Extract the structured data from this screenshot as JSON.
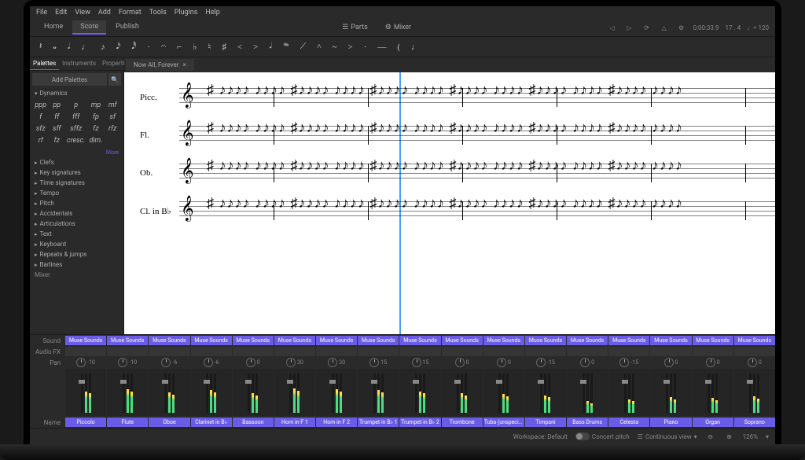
{
  "menu": [
    "File",
    "Edit",
    "View",
    "Add",
    "Format",
    "Tools",
    "Plugins",
    "Help"
  ],
  "mainTabs": [
    "Home",
    "Score",
    "Publish"
  ],
  "activeMainTab": 1,
  "centerTabs": {
    "parts": "Parts",
    "mixer": "Mixer"
  },
  "playback": {
    "time": "0:00:33.9",
    "beat": "17 . 4",
    "tempo": "♩= 120"
  },
  "noteToolbar": [
    "𝄽",
    "𝅝",
    "𝅗𝅥",
    "♩",
    "♪",
    "𝅘𝅥𝅯",
    "𝅘𝅥𝅰",
    "·",
    "𝄐",
    "⌐",
    "♭",
    "♮",
    "♯",
    "<",
    ">",
    "𝆺𝅥",
    "𝆮",
    "⟋",
    "^",
    "~",
    ">",
    "·",
    "—",
    "(",
    "♩"
  ],
  "leftPanel": {
    "tabs": [
      "Palettes",
      "Instruments",
      "Properties"
    ],
    "activeTab": 0,
    "addBtn": "Add Palettes",
    "dynamics": {
      "title": "Dynamics",
      "items": [
        "ppp",
        "pp",
        "p",
        "mp",
        "mf",
        "f",
        "ff",
        "fff",
        "fp",
        "sf",
        "sfz",
        "sff",
        "sffz",
        "fz",
        "rfz",
        "rf",
        "fz",
        "cresc.",
        "dim."
      ],
      "more": "More"
    },
    "sections": [
      "Clefs",
      "Key signatures",
      "Time signatures",
      "Tempo",
      "Pitch",
      "Accidentals",
      "Articulations",
      "Text",
      "Keyboard",
      "Repeats & jumps",
      "Barlines"
    ]
  },
  "docTab": {
    "name": "Now All, Forever"
  },
  "instruments": [
    "Picc.",
    "Fl.",
    "Ob.",
    "Cl. in B♭"
  ],
  "mixer": {
    "label": "Mixer",
    "rows": {
      "sound": "Sound",
      "fx": "Audio FX",
      "pan": "Pan",
      "name": "Name"
    },
    "soundLabel": "Muse Sounds",
    "channels": [
      {
        "name": "Piccolo",
        "pan": -10,
        "meter": 55
      },
      {
        "name": "Flute",
        "pan": -10,
        "meter": 60
      },
      {
        "name": "Oboe",
        "pan": -6,
        "meter": 52
      },
      {
        "name": "Clarinet in B♭",
        "pan": -6,
        "meter": 58
      },
      {
        "name": "Bassoon",
        "pan": 0,
        "meter": 50
      },
      {
        "name": "Horn in F 1",
        "pan": 30,
        "meter": 62
      },
      {
        "name": "Horn in F 2",
        "pan": 30,
        "meter": 60
      },
      {
        "name": "Trumpet in B♭ 1",
        "pan": 15,
        "meter": 58
      },
      {
        "name": "Trumpet in B♭ 2",
        "pan": 15,
        "meter": 55
      },
      {
        "name": "Trombone",
        "pan": 0,
        "meter": 50
      },
      {
        "name": "Tuba (unspecif...",
        "pan": 0,
        "meter": 48
      },
      {
        "name": "Timpani",
        "pan": -15,
        "meter": 45
      },
      {
        "name": "Bass Drums",
        "pan": 0,
        "meter": 30
      },
      {
        "name": "Celesta",
        "pan": -15,
        "meter": 35
      },
      {
        "name": "Piano",
        "pan": 0,
        "meter": 40
      },
      {
        "name": "Organ",
        "pan": 0,
        "meter": 38
      },
      {
        "name": "Soprano",
        "pan": 0,
        "meter": 42
      }
    ]
  },
  "statusBar": {
    "workspace": "Workspace: Default",
    "concertPitch": "Concert pitch",
    "viewMode": "Continuous view",
    "zoom": "126%"
  }
}
